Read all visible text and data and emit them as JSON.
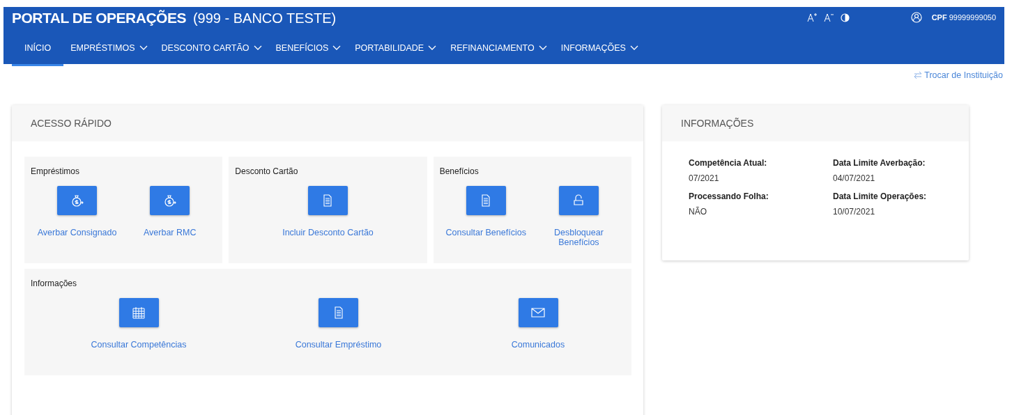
{
  "header": {
    "title": "PORTAL DE OPERAÇÕES",
    "subtitle": "(999 - BANCO TESTE)",
    "cpf_label": "CPF",
    "cpf": "99999999050"
  },
  "nav": [
    {
      "label": "INÍCIO",
      "selected": true,
      "has_menu": false
    },
    {
      "label": "EMPRÉSTIMOS",
      "selected": false,
      "has_menu": true
    },
    {
      "label": "DESCONTO CARTÃO",
      "selected": false,
      "has_menu": true
    },
    {
      "label": "BENEFÍCIOS",
      "selected": false,
      "has_menu": true
    },
    {
      "label": "PORTABILIDADE",
      "selected": false,
      "has_menu": true
    },
    {
      "label": "REFINANCIAMENTO",
      "selected": false,
      "has_menu": true
    },
    {
      "label": "INFORMAÇÕES",
      "selected": false,
      "has_menu": true
    }
  ],
  "switch_link": "Trocar de Instituição",
  "quick_access": {
    "title": "ACESSO RÁPIDO",
    "groups": [
      {
        "title": "Empréstimos",
        "actions": [
          {
            "label": "Averbar Consignado",
            "kind": "money"
          },
          {
            "label": "Averbar RMC",
            "kind": "money"
          }
        ]
      },
      {
        "title": "Desconto Cartão",
        "actions": [
          {
            "label": "Incluir Desconto Cartão",
            "kind": "document"
          }
        ]
      },
      {
        "title": "Benefícios",
        "actions": [
          {
            "label": "Consultar Benefícios",
            "kind": "document"
          },
          {
            "label": "Desbloquear Benefícios",
            "kind": "lock"
          }
        ]
      },
      {
        "title": "Informações",
        "actions": [
          {
            "label": "Consultar Competências",
            "kind": "calendar"
          },
          {
            "label": "Consultar Empréstimo",
            "kind": "document"
          },
          {
            "label": "Comunicados",
            "kind": "mail"
          }
        ]
      }
    ]
  },
  "info": {
    "title": "INFORMAÇÕES",
    "fields": [
      {
        "label": "Competência Atual:",
        "value": "07/2021"
      },
      {
        "label": "Data Limite Averbação:",
        "value": "04/07/2021"
      },
      {
        "label": "Processando Folha:",
        "value": "NÃO"
      },
      {
        "label": "Data Limite Operações:",
        "value": "10/07/2021"
      }
    ]
  }
}
